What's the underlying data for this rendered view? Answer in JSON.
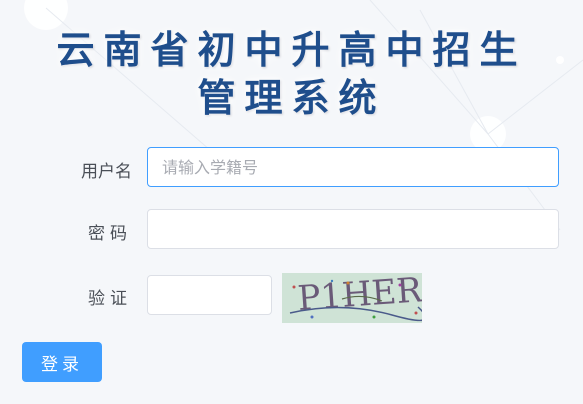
{
  "title": {
    "line1": "云南省初中升高中招生",
    "line2": "管理系统"
  },
  "form": {
    "username_label": "用户名",
    "username_placeholder": "请输入学籍号",
    "username_value": "",
    "password_label": "密码",
    "password_value": "",
    "verify_label": "验证",
    "verify_value": "",
    "captcha_text": "P1HER"
  },
  "login_button": "登录",
  "colors": {
    "accent": "#409eff",
    "title": "#1f4e8c",
    "background": "#f5f7fa"
  }
}
